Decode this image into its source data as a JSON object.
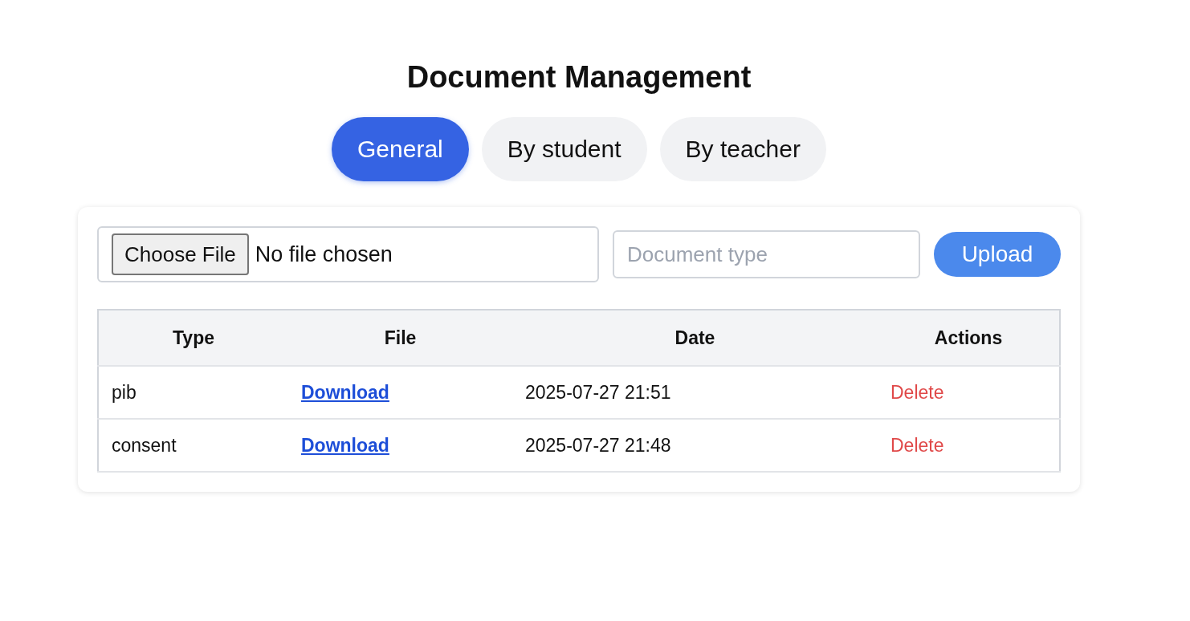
{
  "title": "Document Management",
  "tabs": [
    {
      "label": "General",
      "selected": true
    },
    {
      "label": "By student",
      "selected": false
    },
    {
      "label": "By teacher",
      "selected": false
    }
  ],
  "upload": {
    "choose_button": "Choose File",
    "file_status": "No file chosen",
    "type_field": {
      "placeholder": "Document type"
    },
    "submit": "Upload"
  },
  "table": {
    "columns": [
      "Type",
      "File",
      "Date",
      "Actions"
    ],
    "rows": [
      {
        "type": "pib",
        "file": "Download",
        "date": "2025-07-27 21:51",
        "action": "Delete"
      },
      {
        "type": "consent",
        "file": "Download",
        "date": "2025-07-27 21:48",
        "action": "Delete"
      }
    ]
  }
}
